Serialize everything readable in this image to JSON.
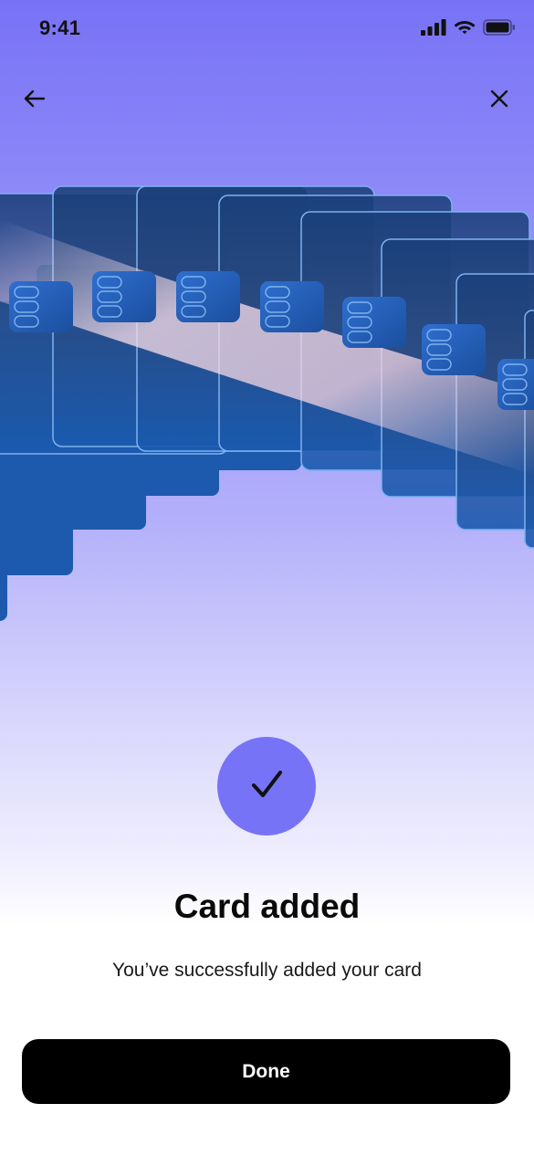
{
  "status_bar": {
    "time": "9:41",
    "icons": [
      "cellular-signal-icon",
      "wifi-icon",
      "battery-icon"
    ]
  },
  "nav": {
    "back_icon": "arrow-left-icon",
    "close_icon": "close-icon"
  },
  "hero": {
    "image": "stacked-cards-illustration"
  },
  "success": {
    "icon": "checkmark-icon",
    "title": "Card added",
    "message": "You’ve successfully added your card"
  },
  "actions": {
    "done_label": "Done"
  },
  "colors": {
    "accent": "#7773F7",
    "button_bg": "#000000",
    "button_text": "#FFFFFF",
    "card_blue": "#1B5AAE"
  }
}
